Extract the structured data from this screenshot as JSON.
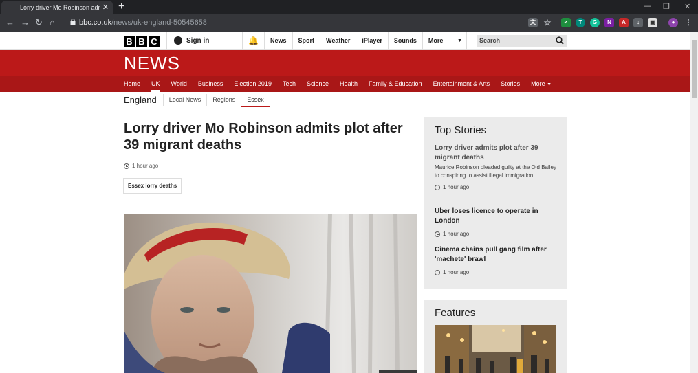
{
  "browser": {
    "tab_title": "Lorry driver Mo Robinson admits p",
    "tab_favicon": "···",
    "url_domain": "bbc.co.uk",
    "url_path": "/news/uk-england-50545658"
  },
  "masthead": {
    "logo_letters": [
      "B",
      "B",
      "C"
    ],
    "signin_label": "Sign in",
    "nav": [
      "News",
      "Sport",
      "Weather",
      "iPlayer",
      "Sounds"
    ],
    "more_label": "More",
    "search_placeholder": "Search"
  },
  "news": {
    "wordmark": "NEWS",
    "sections": [
      "Home",
      "UK",
      "World",
      "Business",
      "Election 2019",
      "Tech",
      "Science",
      "Health",
      "Family & Education",
      "Entertainment & Arts",
      "Stories",
      "More"
    ],
    "active_section": "UK"
  },
  "subnav": {
    "region": "England",
    "items": [
      "Local News",
      "Regions",
      "Essex"
    ],
    "active": "Essex"
  },
  "article": {
    "headline": "Lorry driver Mo Robinson admits plot after 39 migrant deaths",
    "timestamp": "1 hour ago",
    "tag": "Essex lorry deaths"
  },
  "top_stories": {
    "title": "Top Stories",
    "stories": [
      {
        "title": "Lorry driver admits plot after 39 migrant deaths",
        "summary": "Maurice Robinson pleaded guilty at the Old Bailey to conspiring to assist illegal immigration.",
        "time": "1 hour ago"
      },
      {
        "title": "Uber loses licence to operate in London",
        "summary": "",
        "time": "1 hour ago"
      },
      {
        "title": "Cinema chains pull gang film after 'machete' brawl",
        "summary": "",
        "time": "1 hour ago"
      }
    ]
  },
  "features": {
    "title": "Features"
  },
  "colors": {
    "bbc_red": "#bb1919",
    "section_bar": "#a91717",
    "chrome_dark": "#202124"
  }
}
